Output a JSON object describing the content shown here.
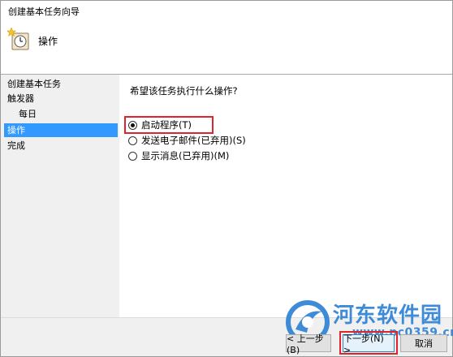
{
  "window": {
    "title": "创建基本任务向导"
  },
  "header": {
    "title": "操作",
    "icon": "clock-star-icon"
  },
  "nav": {
    "items": [
      {
        "label": "创建基本任务",
        "active": false,
        "sub": false
      },
      {
        "label": "触发器",
        "active": false,
        "sub": false
      },
      {
        "label": "每日",
        "active": false,
        "sub": true
      },
      {
        "label": "操作",
        "active": true,
        "sub": false
      },
      {
        "label": "完成",
        "active": false,
        "sub": false
      }
    ]
  },
  "content": {
    "question": "希望该任务执行什么操作?",
    "options": [
      {
        "label": "启动程序(T)",
        "checked": true
      },
      {
        "label": "发送电子邮件(已弃用)(S)",
        "checked": false
      },
      {
        "label": "显示消息(已弃用)(M)",
        "checked": false
      }
    ]
  },
  "footer": {
    "back_label": "< 上一步(B)",
    "next_label": "下一步(N) >",
    "cancel_label": "取消"
  },
  "watermark": {
    "text": "河东软件园",
    "url": "www.pc0359.cn"
  },
  "colors": {
    "highlight": "#e0242b",
    "nav_active": "#3399ff",
    "watermark": "#2a7fd4"
  }
}
